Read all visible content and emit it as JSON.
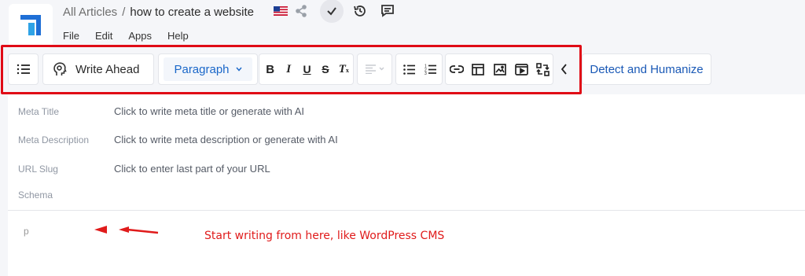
{
  "header": {
    "breadcrumb_root": "All Articles",
    "breadcrumb_sep": "/",
    "article_title": "how to create a website",
    "icons": [
      "flag-us-icon",
      "share-icon",
      "check-icon",
      "history-icon",
      "comment-icon"
    ]
  },
  "menu": {
    "file": "File",
    "edit": "Edit",
    "apps": "Apps",
    "help": "Help"
  },
  "toolbar": {
    "write_ahead": "Write Ahead",
    "paragraph": "Paragraph",
    "detect_humanize": "Detect and Humanize",
    "icons": [
      "list-icon",
      "ai-head-icon",
      "bold-icon",
      "italic-icon",
      "underline-icon",
      "strikethrough-icon",
      "clear-format-icon",
      "align-left-icon",
      "bullet-list-icon",
      "numbered-list-icon",
      "link-icon",
      "table-icon",
      "image-icon",
      "video-icon",
      "embed-icon",
      "collapse-icon"
    ]
  },
  "meta": {
    "title_label": "Meta Title",
    "title_value": "Click to write meta title or generate with AI",
    "desc_label": "Meta Description",
    "desc_value": "Click to write meta description or generate with AI",
    "slug_label": "URL Slug",
    "slug_value": "Click to enter last part of your URL",
    "schema_label": "Schema"
  },
  "editor": {
    "block_tag": "p",
    "annotation": "Start writing from here, like WordPress CMS"
  },
  "colors": {
    "accent": "#1a67c9",
    "highlight": "#e00b16"
  }
}
